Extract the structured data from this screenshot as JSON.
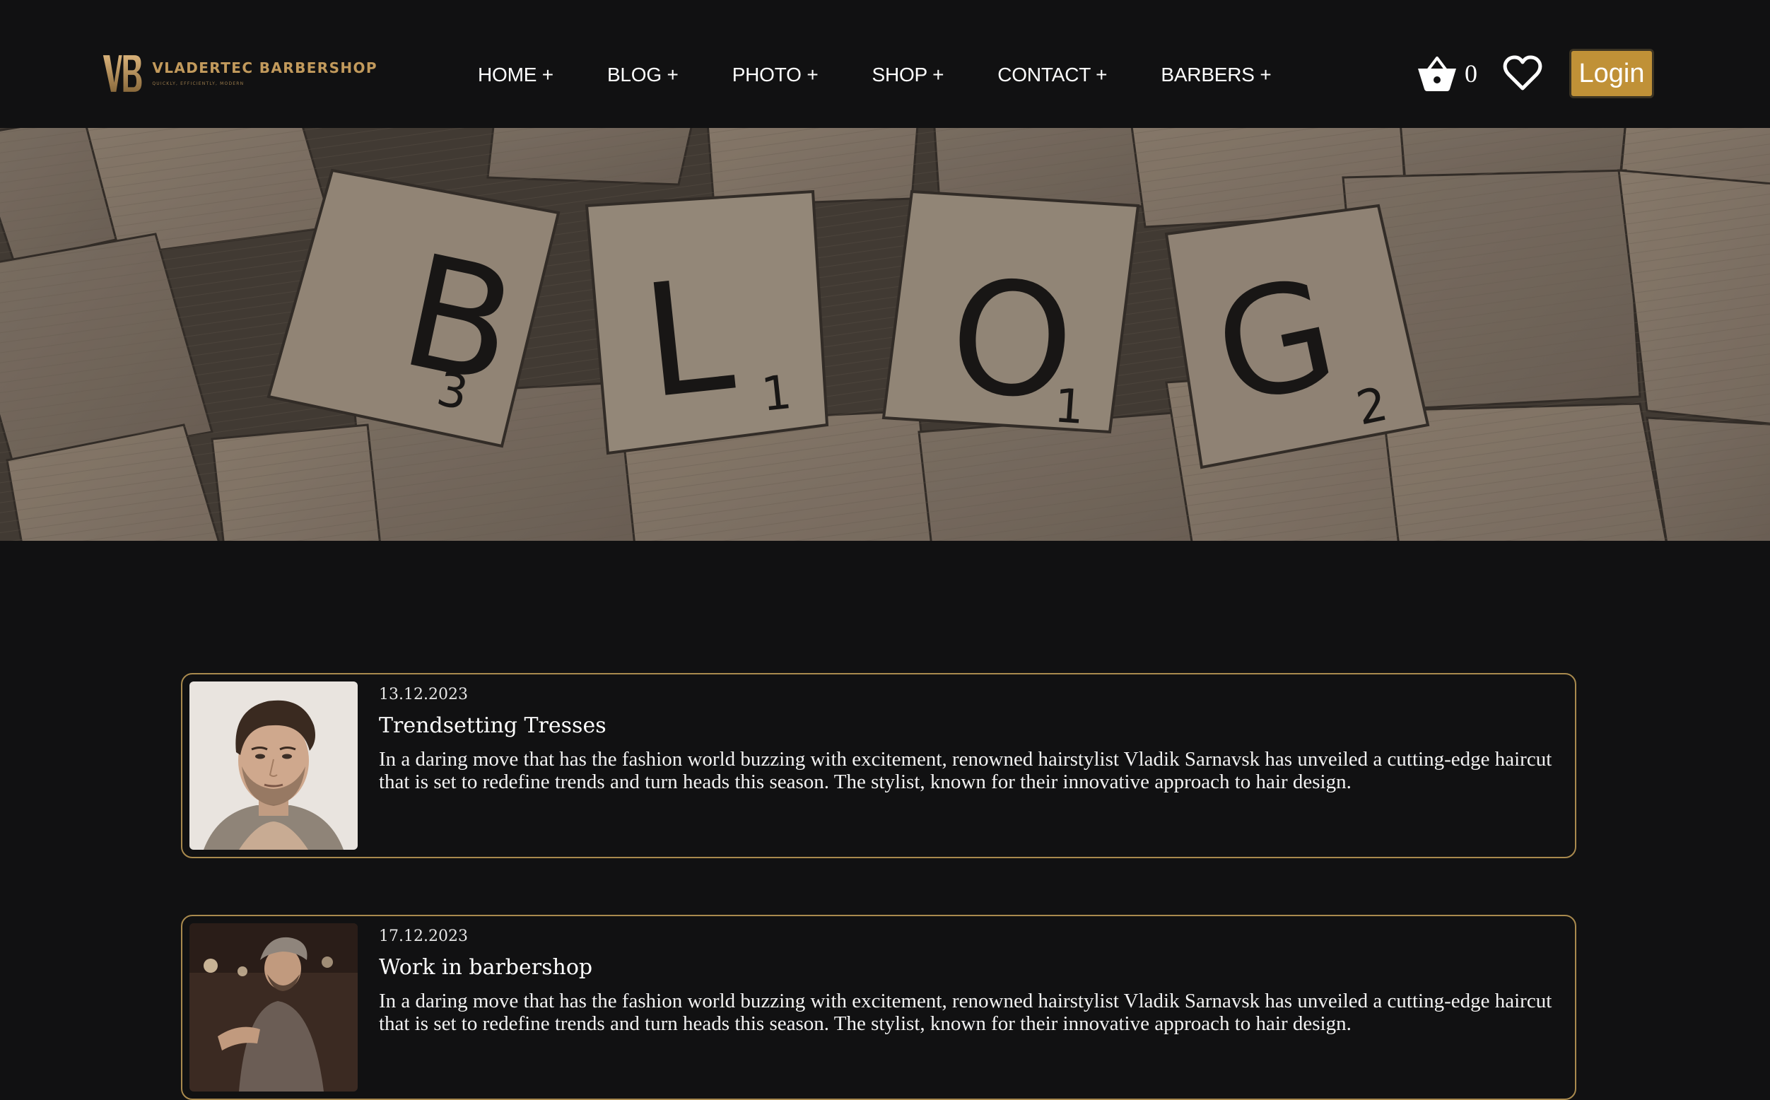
{
  "brand": {
    "name": "VLADERTEC BARBERSHOP",
    "tagline": "QUICKLY, EFFICIENTLY, MODERN",
    "monogram": "VB",
    "color": "#c29a5c"
  },
  "nav": {
    "items": [
      {
        "label": "HOME +"
      },
      {
        "label": "BLOG +"
      },
      {
        "label": "PHOTO +"
      },
      {
        "label": "SHOP +"
      },
      {
        "label": "CONTACT +"
      },
      {
        "label": "BARBERS +"
      }
    ]
  },
  "cart": {
    "icon": "basket-icon",
    "count": "0"
  },
  "wishlist": {
    "icon": "heart-icon"
  },
  "login": {
    "label": "Login",
    "color": "#c09137"
  },
  "hero": {
    "tiles": [
      {
        "letter": "B",
        "score": "3"
      },
      {
        "letter": "L",
        "score": "1"
      },
      {
        "letter": "O",
        "score": "1"
      },
      {
        "letter": "G",
        "score": "2"
      }
    ]
  },
  "posts": [
    {
      "date": "13.12.2023",
      "title": "Trendsetting Tresses",
      "text": "In a daring move that has the fashion world buzzing with excitement, renowned hairstylist Vladik Sarnavsk has unveiled a cutting-edge haircut that is set to redefine trends and turn heads this season. The stylist, known for their innovative approach to hair design."
    },
    {
      "date": "17.12.2023",
      "title": "Work in barbershop",
      "text": "In a daring move that has the fashion world buzzing with excitement, renowned hairstylist Vladik Sarnavsk has unveiled a cutting-edge haircut that is set to redefine trends and turn heads this season. The stylist, known for their innovative approach to hair design."
    }
  ],
  "colors": {
    "background": "#111112",
    "accent": "#a98a4e"
  }
}
